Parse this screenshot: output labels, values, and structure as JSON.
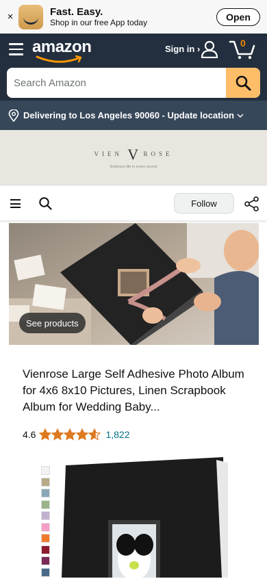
{
  "app_banner": {
    "close": "×",
    "title": "Fast. Easy.",
    "subtitle": "Shop in our free App today",
    "open_label": "Open"
  },
  "header": {
    "logo_text": "amazon",
    "signin_label": "Sign in ›",
    "cart_count": "0",
    "search_placeholder": "Search Amazon"
  },
  "location": {
    "text": "Delivering to Los Angeles 90060 - Update location"
  },
  "brand": {
    "name_left": "VIEN",
    "monogram": "V",
    "name_right": "ROSE",
    "tagline": "Embrace life in every record"
  },
  "toolbar": {
    "follow_label": "Follow"
  },
  "hero": {
    "see_products_label": "See products"
  },
  "product": {
    "title": "Vienrose Large Self Adhesive Photo Album for 4x6 8x10 Pictures, Linen Scrapbook Album for Wedding Baby...",
    "rating_value": "4.6",
    "rating_stars": 4.6,
    "review_count": "1,822",
    "swatch_colors": [
      "#f2f2f2",
      "#b8a98a",
      "#8aa7b8",
      "#9ab58a",
      "#c2b0cf",
      "#f59fc8",
      "#ef7a2c",
      "#8b1a2e",
      "#7a2a54",
      "#4a6a8a"
    ]
  },
  "colors": {
    "header_bg": "#232f3e",
    "location_bg": "#37475a",
    "search_button": "#febd69",
    "accent_orange": "#f08804",
    "star": "#de7921",
    "link": "#007185"
  },
  "icons": {
    "menu": "hamburger-icon",
    "user": "user-icon",
    "cart": "cart-icon",
    "search": "search-icon",
    "location": "location-pin-icon",
    "share": "share-icon"
  }
}
